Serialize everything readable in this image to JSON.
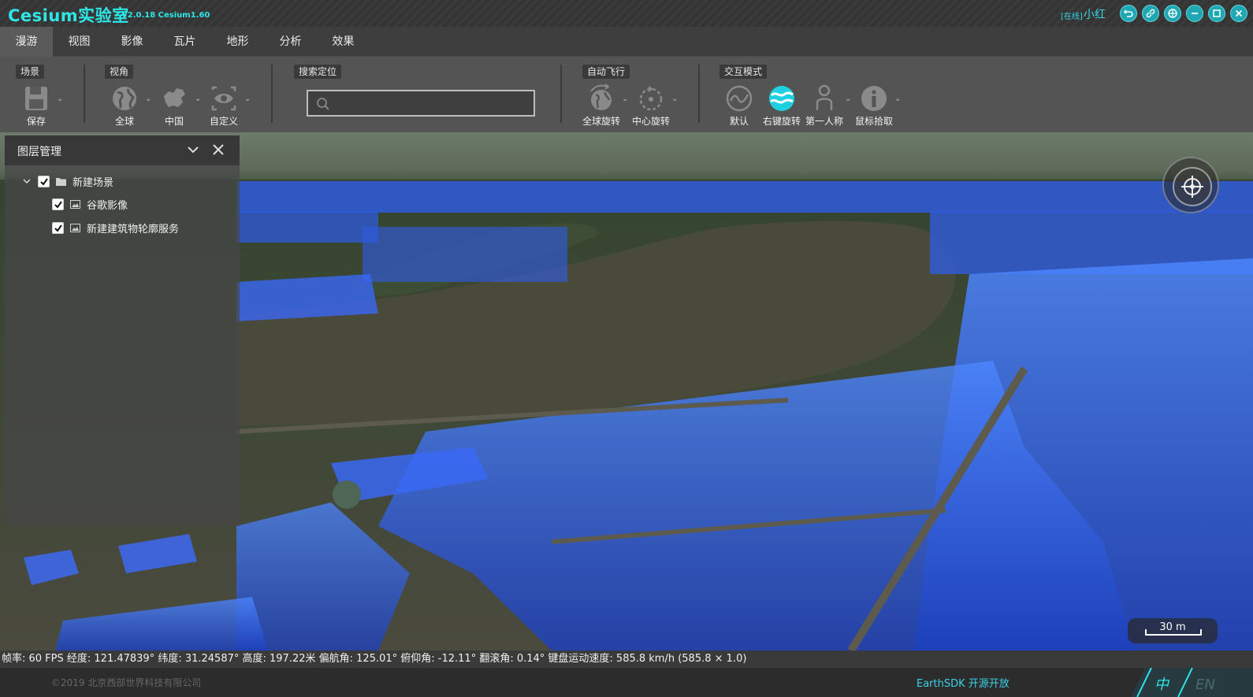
{
  "titlebar": {
    "app_title": "Cesium实验室",
    "version": "V2.0.18  Cesium1.60",
    "user_status": "[在线]",
    "user_name": "小红"
  },
  "menu": {
    "tabs": [
      "漫游",
      "视图",
      "影像",
      "瓦片",
      "地形",
      "分析",
      "效果"
    ],
    "active": "漫游"
  },
  "ribbon": {
    "groups": {
      "scene": "场景",
      "view": "视角",
      "search": "搜索定位",
      "autofly": "自动飞行",
      "interaction": "交互模式"
    },
    "tools": {
      "save": "保存",
      "globe": "全球",
      "china": "中国",
      "custom": "自定义",
      "global_rotate": "全球旋转",
      "center_rotate": "中心旋转",
      "default": "默认",
      "right_rotate": "右键旋转",
      "first_person": "第一人称",
      "mouse_pick": "鼠标拾取"
    },
    "search_placeholder": ""
  },
  "layer_panel": {
    "title": "图层管理",
    "root": {
      "label": "新建场景",
      "checked": true,
      "expanded": true
    },
    "children": [
      {
        "label": "谷歌影像",
        "checked": true
      },
      {
        "label": "新建建筑物轮廓服务",
        "checked": true
      }
    ]
  },
  "scale": {
    "label": "30 m"
  },
  "status": {
    "text": "帧率: 60 FPS 经度: 121.47839° 纬度: 31.24587° 高度: 197.22米 偏航角: 125.01° 俯仰角: -12.11° 翻滚角: 0.14° 键盘运动速度: 585.8 km/h (585.8 × 1.0)"
  },
  "footer": {
    "copyright": "©2019 北京西部世界科技有限公司",
    "earthsdk": "EarthSDK 开源开放",
    "lang_zh": "中",
    "lang_en": "EN"
  },
  "colors": {
    "accent": "#2ee6e6",
    "building": "#2f6bff",
    "river": "#4a4a3c"
  }
}
